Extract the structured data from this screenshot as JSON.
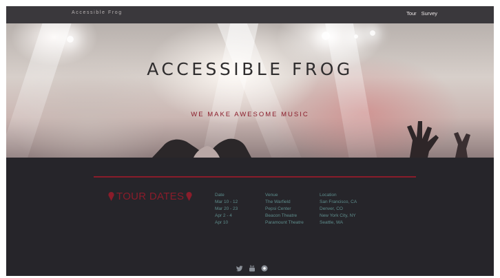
{
  "navbar": {
    "brand": "Accessible Frog",
    "links": [
      {
        "label": "Tour"
      },
      {
        "label": "Survey"
      }
    ]
  },
  "hero": {
    "title": "ACCESSIBLE FROG",
    "subtitle": "WE MAKE AWESOME MUSIC"
  },
  "tour": {
    "heading": "TOUR DATES",
    "columns": {
      "date": "Date",
      "venue": "Venue",
      "location": "Location"
    },
    "rows": [
      {
        "date": "Mar 10 - 12",
        "venue": "The Warfield",
        "location": "San Francisco, CA"
      },
      {
        "date": "Mar 20 - 23",
        "venue": "Pepsi Center",
        "location": "Denver, CO"
      },
      {
        "date": "Apr 2 - 4",
        "venue": "Beacon Theatre",
        "location": "New York City, NY"
      },
      {
        "date": "Apr 10",
        "venue": "Paramount Theatre",
        "location": "Seattle, WA"
      }
    ]
  },
  "social": [
    {
      "icon": "twitter-icon"
    },
    {
      "icon": "youtube-icon"
    },
    {
      "icon": "instagram-icon"
    }
  ],
  "colors": {
    "accent": "#8a1c2a",
    "table_text": "#5f8e8d",
    "background": "#26252a"
  }
}
